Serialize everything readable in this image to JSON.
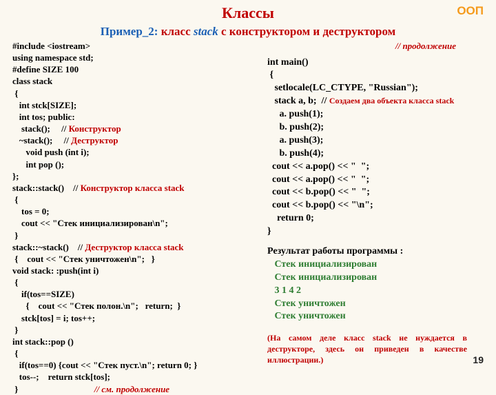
{
  "tag": "ООП",
  "title": "Классы",
  "subtitle": {
    "label": "Пример_2:",
    "text_before": "класс ",
    "stack_word": "stack",
    "text_after": " с конструктором и деструктором"
  },
  "left_code": {
    "l1": "#include <iostream>",
    "l2": "using namespace std;",
    "l3": "#define SIZE 100",
    "l4": "class stack",
    "l5": " {",
    "l6": "   int stck[SIZE];",
    "l7": "   int tos; public:",
    "l8": "    stack();     // ",
    "l8r": "Конструктор",
    "l9": "   ~stack();     // ",
    "l9r": "Деструктор",
    "l10": "      void push (int i);",
    "l11": "      int pop ();",
    "l12": "};",
    "l13": "stack::stack()    // ",
    "l13r": "Конструктор класса stack",
    "l14": " {",
    "l15": "    tos = 0;",
    "l16": "    cout << \"Стек инициализирован\\n\";",
    "l17": " }",
    "l18": "stack::~stack()    // ",
    "l18r": "Деструктор класса stack",
    "l19": " {    cout << \"Стек уничтожен\\n\";   }",
    "l20": "void stack: :push(int i)",
    "l21": " {",
    "l22": "    if(tos==SIZE)",
    "l23": "      {    cout << \"Стек полон.\\n\";   return;  }",
    "l24": "    stck[tos] = i; tos++;",
    "l25": " }",
    "l26": "int stack::pop ()",
    "l27": " {",
    "l28": "   if(tos==0) {cout << \"Стек пуст.\\n\"; return 0; }",
    "l29": "   tos--;    return stck[tos];",
    "l30": " }                                  ",
    "l30r": "// см. продолжение"
  },
  "right_code": {
    "cont": "//  продолжение",
    "m1": "int main()",
    "m2": " {",
    "m3": "   setlocale(LC_CTYPE, \"Russian\");",
    "m4a": "   stack a, b;  // ",
    "m4r": "Создаем два объекта класса stack",
    "m5": "     a. push(1);",
    "m6": "     b. push(2);",
    "m7": "     a. push(3);",
    "m8": "     b. push(4);",
    "m9": "  cout << a.pop() << \"  \";",
    "m10": "  cout << a.pop() << \"  \";",
    "m11": "  cout << b.pop() << \"  \";",
    "m12": "  cout << b.pop() << \"\\n\";",
    "m13": "    return 0;",
    "m14": "}"
  },
  "result": {
    "header": "Результат работы программы :",
    "r1": "   Стек инициализирован",
    "r2": "   Стек инициализирован",
    "r3": "   3 1 4 2",
    "r4": "   Стек уничтожен",
    "r5": "   Стек уничтожен"
  },
  "note": "(На самом деле класс stack не нуждается в деструкторе, здесь он приведен в качестве иллюстрации.)",
  "pagenum": "19"
}
